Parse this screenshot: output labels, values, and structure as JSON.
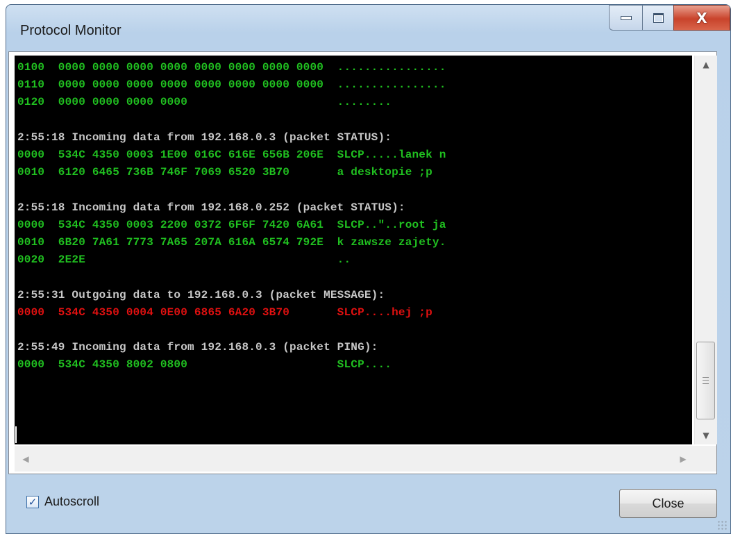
{
  "window": {
    "title": "Protocol Monitor",
    "buttons": {
      "close_glyph": "X"
    }
  },
  "log": {
    "lines": [
      {
        "text": "0100  0000 0000 0000 0000 0000 0000 0000 0000  ................",
        "color": "green"
      },
      {
        "text": "0110  0000 0000 0000 0000 0000 0000 0000 0000  ................",
        "color": "green"
      },
      {
        "text": "0120  0000 0000 0000 0000                      ........",
        "color": "green"
      },
      {
        "text": "",
        "color": "green"
      },
      {
        "text": "2:55:18 Incoming data from 192.168.0.3 (packet STATUS):",
        "color": "grey"
      },
      {
        "text": "0000  534C 4350 0003 1E00 016C 616E 656B 206E  SLCP.....lanek n",
        "color": "green"
      },
      {
        "text": "0010  6120 6465 736B 746F 7069 6520 3B70       a desktopie ;p",
        "color": "green"
      },
      {
        "text": "",
        "color": "green"
      },
      {
        "text": "2:55:18 Incoming data from 192.168.0.252 (packet STATUS):",
        "color": "grey"
      },
      {
        "text": "0000  534C 4350 0003 2200 0372 6F6F 7420 6A61  SLCP..\"..root ja",
        "color": "green"
      },
      {
        "text": "0010  6B20 7A61 7773 7A65 207A 616A 6574 792E  k zawsze zajety.",
        "color": "green"
      },
      {
        "text": "0020  2E2E                                     ..",
        "color": "green"
      },
      {
        "text": "",
        "color": "green"
      },
      {
        "text": "2:55:31 Outgoing data to 192.168.0.3 (packet MESSAGE):",
        "color": "grey"
      },
      {
        "text": "0000  534C 4350 0004 0E00 6865 6A20 3B70       SLCP....hej ;p",
        "color": "red"
      },
      {
        "text": "",
        "color": "green"
      },
      {
        "text": "2:55:49 Incoming data from 192.168.0.3 (packet PING):",
        "color": "grey"
      },
      {
        "text": "0000  534C 4350 8002 0800                      SLCP....",
        "color": "green"
      }
    ]
  },
  "scrollbar": {
    "up_glyph": "▲",
    "down_glyph": "▼",
    "left_glyph": "◀",
    "right_glyph": "▶"
  },
  "footer": {
    "autoscroll_label": "Autoscroll",
    "autoscroll_checked": true,
    "check_glyph": "✓",
    "close_label": "Close"
  },
  "colors": {
    "green": "#20c020",
    "grey": "#c8c8c8",
    "red": "#e01010",
    "terminal_bg": "#000000"
  }
}
